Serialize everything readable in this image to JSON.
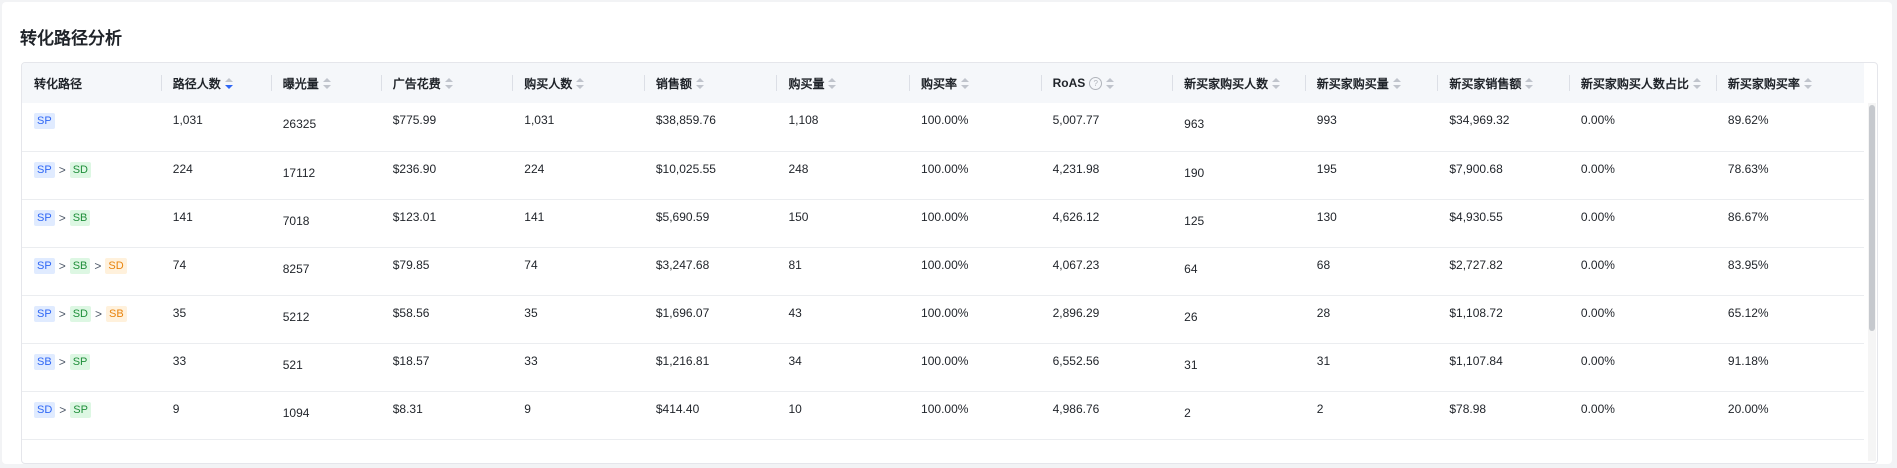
{
  "title": "转化路径分析",
  "columns": [
    {
      "label": "转化路径",
      "sort": "none"
    },
    {
      "label": "路径人数",
      "sort": "desc"
    },
    {
      "label": "曝光量",
      "sort": "both"
    },
    {
      "label": "广告花费",
      "sort": "both"
    },
    {
      "label": "购买人数",
      "sort": "both"
    },
    {
      "label": "销售额",
      "sort": "both"
    },
    {
      "label": "购买量",
      "sort": "both"
    },
    {
      "label": "购买率",
      "sort": "both"
    },
    {
      "label": "RoAS",
      "sort": "both",
      "help": "?"
    },
    {
      "label": "新买家购买人数",
      "sort": "both"
    },
    {
      "label": "新买家购买量",
      "sort": "both"
    },
    {
      "label": "新买家销售额",
      "sort": "both"
    },
    {
      "label": "新买家购买人数占比",
      "sort": "both"
    },
    {
      "label": "新买家购买率",
      "sort": "both"
    }
  ],
  "rows": [
    {
      "path": [
        {
          "t": "SP",
          "c": "SP"
        }
      ],
      "cells": [
        "1,031",
        "26325",
        "$775.99",
        "1,031",
        "$38,859.76",
        "1,108",
        "100.00%",
        "5,007.77",
        "963",
        "993",
        "$34,969.32",
        "0.00%",
        "89.62%"
      ]
    },
    {
      "path": [
        {
          "t": "SP",
          "c": "SP"
        },
        {
          "t": "SD",
          "c": "SD"
        }
      ],
      "cells": [
        "224",
        "17112",
        "$236.90",
        "224",
        "$10,025.55",
        "248",
        "100.00%",
        "4,231.98",
        "190",
        "195",
        "$7,900.68",
        "0.00%",
        "78.63%"
      ]
    },
    {
      "path": [
        {
          "t": "SP",
          "c": "SP"
        },
        {
          "t": "SB",
          "c": "SB-green"
        }
      ],
      "cells": [
        "141",
        "7018",
        "$123.01",
        "141",
        "$5,690.59",
        "150",
        "100.00%",
        "4,626.12",
        "125",
        "130",
        "$4,930.55",
        "0.00%",
        "86.67%"
      ]
    },
    {
      "path": [
        {
          "t": "SP",
          "c": "SP"
        },
        {
          "t": "SB",
          "c": "SB-green"
        },
        {
          "t": "SD",
          "c": "SD-orange"
        }
      ],
      "cells": [
        "74",
        "8257",
        "$79.85",
        "74",
        "$3,247.68",
        "81",
        "100.00%",
        "4,067.23",
        "64",
        "68",
        "$2,727.82",
        "0.00%",
        "83.95%"
      ]
    },
    {
      "path": [
        {
          "t": "SP",
          "c": "SP"
        },
        {
          "t": "SD",
          "c": "SD"
        },
        {
          "t": "SB",
          "c": "SB-orange"
        }
      ],
      "cells": [
        "35",
        "5212",
        "$58.56",
        "35",
        "$1,696.07",
        "43",
        "100.00%",
        "2,896.29",
        "26",
        "28",
        "$1,108.72",
        "0.00%",
        "65.12%"
      ]
    },
    {
      "path": [
        {
          "t": "SB",
          "c": "SP"
        },
        {
          "t": "SP",
          "c": "SD"
        }
      ],
      "cells": [
        "33",
        "521",
        "$18.57",
        "33",
        "$1,216.81",
        "34",
        "100.00%",
        "6,552.56",
        "31",
        "31",
        "$1,107.84",
        "0.00%",
        "91.18%"
      ]
    },
    {
      "path": [
        {
          "t": "SD",
          "c": "SP"
        },
        {
          "t": "SP",
          "c": "SD"
        }
      ],
      "cells": [
        "9",
        "1094",
        "$8.31",
        "9",
        "$414.40",
        "10",
        "100.00%",
        "4,986.76",
        "2",
        "2",
        "$78.98",
        "0.00%",
        "20.00%"
      ]
    }
  ],
  "path_separator": ">",
  "colors": {
    "accent": "#2e66f5",
    "tag_blue_bg": "#e0ebff",
    "tag_green_bg": "#ddf7e3",
    "tag_orange_bg": "#fff1dc"
  },
  "icons": {
    "sort": "sort-caret-icon",
    "help": "question-circle-icon"
  }
}
